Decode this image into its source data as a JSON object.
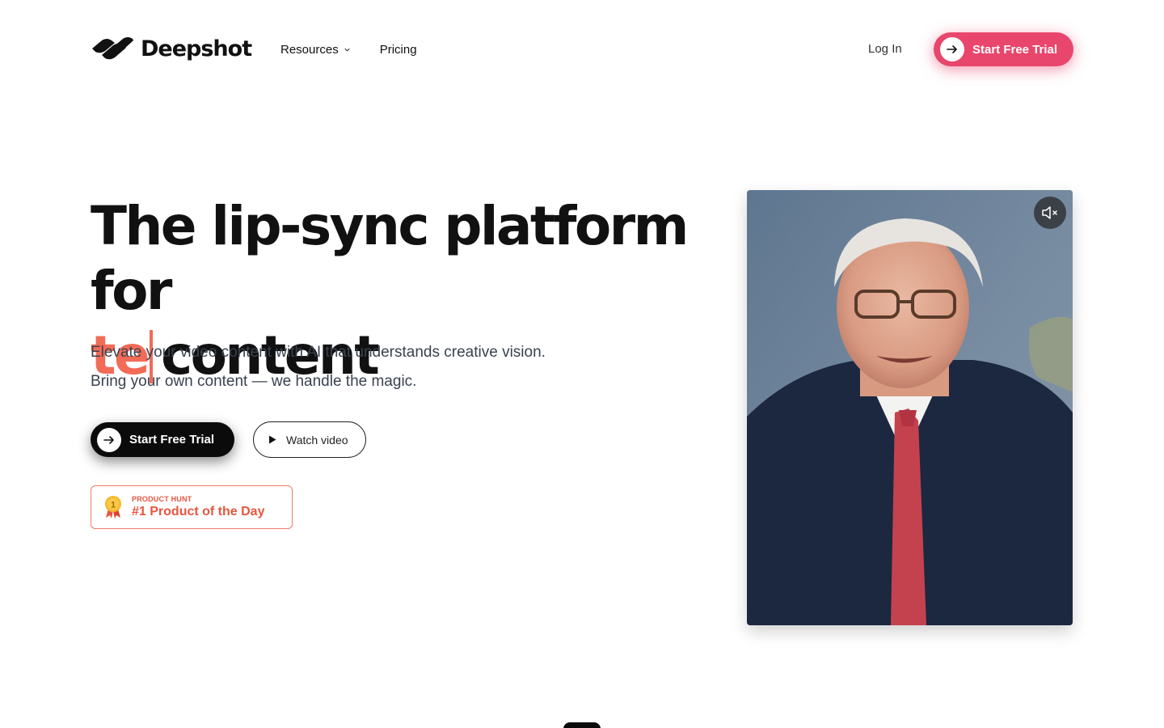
{
  "brand": {
    "name": "Deepshot"
  },
  "nav": {
    "items": [
      {
        "label": "Resources",
        "has_dropdown": true
      },
      {
        "label": "Pricing",
        "has_dropdown": false
      }
    ]
  },
  "header": {
    "login_label": "Log In",
    "cta_label": "Start Free Trial"
  },
  "hero": {
    "title_line1": "The lip-sync platform for",
    "typed_text": "te",
    "title_line2_rest": "content",
    "subtitle_line1": "Elevate your video content with AI that understands creative vision.",
    "subtitle_line2": "Bring your own content — we handle the magic.",
    "primary_cta_label": "Start Free Trial",
    "secondary_cta_label": "Watch video"
  },
  "badge": {
    "label_small": "PRODUCT HUNT",
    "label_big": "#1 Product of the Day",
    "medal_number": "1"
  },
  "video": {
    "muted": true
  },
  "colors": {
    "accent": "#e8466c",
    "typed": "#f26b57",
    "badge": "#e8553f",
    "dark": "#0b0b0b"
  },
  "icons": {
    "logo": "deepshot-logo-icon",
    "arrow": "arrow-right-icon",
    "play": "play-icon",
    "mute": "speaker-muted-icon",
    "chevron": "chevron-down-icon",
    "medal": "medal-icon"
  }
}
